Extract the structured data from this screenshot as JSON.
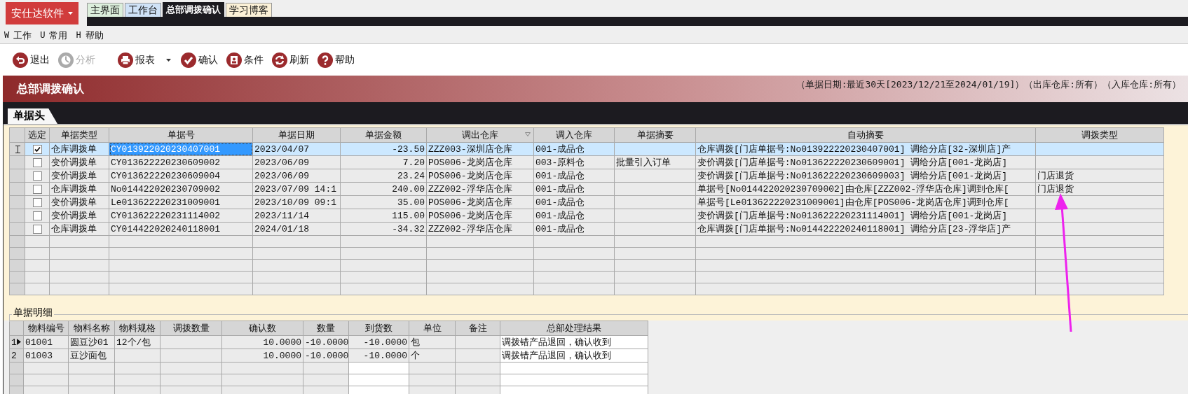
{
  "app_button": {
    "label": "安仕达软件"
  },
  "tabs": [
    {
      "label": "主界面",
      "selected": false,
      "color": "#dcefdc"
    },
    {
      "label": "工作台",
      "selected": false,
      "color": "#cfe2f7"
    },
    {
      "label": "总部调拨确认",
      "selected": true,
      "color": "#1c1b20"
    },
    {
      "label": "学习博客",
      "selected": false,
      "color": "#fbf0d6"
    }
  ],
  "menu": [
    {
      "key": "W",
      "label": "工作"
    },
    {
      "key": "U",
      "label": "常用"
    },
    {
      "key": "H",
      "label": "帮助"
    }
  ],
  "toolbar": [
    {
      "label": "退出",
      "disabled": false
    },
    {
      "label": "分析",
      "disabled": true
    },
    {
      "label": "报表",
      "disabled": false,
      "dropdown": true
    },
    {
      "label": "确认",
      "disabled": false
    },
    {
      "label": "条件",
      "disabled": false
    },
    {
      "label": "刷新",
      "disabled": false
    },
    {
      "label": "帮助",
      "disabled": false
    }
  ],
  "title_band": {
    "title": "总部调拨确认",
    "criteria": "（单据日期:最近30天[2023/12/21至2024/01/19]）（出库仓库:所有）（入库仓库:所有）"
  },
  "header_tab": {
    "label": "单据头"
  },
  "table": {
    "columns": [
      {
        "label": "选定"
      },
      {
        "label": "单据类型"
      },
      {
        "label": "单据号"
      },
      {
        "label": "单据日期"
      },
      {
        "label": "单据金额"
      },
      {
        "label": "调出仓库",
        "filter": true
      },
      {
        "label": "调入仓库"
      },
      {
        "label": "单据摘要"
      },
      {
        "label": "自动摘要"
      },
      {
        "label": "调拨类型"
      }
    ],
    "rows": [
      {
        "selected": true,
        "current": true,
        "checked": true,
        "cells": [
          "",
          "仓库调拨单",
          "CY013922020230407001",
          "2023/04/07",
          "-23.50",
          "ZZZ003-深圳店仓库",
          "001-成品仓",
          null,
          "仓库调拨[门店单据号:No013922220230407001] 调给分店[32-深圳店]产",
          null
        ]
      },
      {
        "selected": false,
        "current": false,
        "checked": false,
        "cells": [
          "",
          "变价调拨单",
          "CY013622220230609002",
          "2023/06/09",
          "7.20",
          "POS006-龙岗店仓库",
          "003-原料仓",
          "批量引入订单",
          "变价调拨[门店单据号:No013622220230609001] 调给分店[001-龙岗店]",
          null
        ]
      },
      {
        "selected": false,
        "current": false,
        "checked": false,
        "cells": [
          "",
          "变价调拨单",
          "CY013622220230609004",
          "2023/06/09",
          "23.24",
          "POS006-龙岗店仓库",
          "001-成品仓",
          null,
          "变价调拨[门店单据号:No013622220230609003] 调给分店[001-龙岗店]",
          "门店退货"
        ]
      },
      {
        "selected": false,
        "current": false,
        "checked": false,
        "cells": [
          "",
          "仓库调拨单",
          "No014422020230709002",
          "2023/07/09 14:1",
          "240.00",
          "ZZZ002-浮华店仓库",
          "001-成品仓",
          null,
          "单据号[No014422020230709002]由仓库[ZZZ002-浮华店仓库]调到仓库[",
          "门店退货"
        ]
      },
      {
        "selected": false,
        "current": false,
        "checked": false,
        "cells": [
          "",
          "变价调拨单",
          "Le013622220231009001",
          "2023/10/09 09:1",
          "35.00",
          "POS006-龙岗店仓库",
          "001-成品仓",
          null,
          "单据号[Le013622220231009001]由仓库[POS006-龙岗店仓库]调到仓库[",
          null
        ]
      },
      {
        "selected": false,
        "current": false,
        "checked": false,
        "cells": [
          "",
          "变价调拨单",
          "CY013622220231114002",
          "2023/11/14",
          "115.00",
          "POS006-龙岗店仓库",
          "001-成品仓",
          null,
          "变价调拨[门店单据号:No013622220231114001] 调给分店[001-龙岗店]",
          null
        ]
      },
      {
        "selected": false,
        "current": false,
        "checked": false,
        "cells": [
          "",
          "仓库调拨单",
          "CY014422020240118001",
          "2024/01/18",
          "-34.32",
          "ZZZ002-浮华店仓库",
          "001-成品仓",
          null,
          "仓库调拨[门店单据号:No014422220240118001] 调给分店[23-浮华店]产",
          null
        ]
      }
    ]
  },
  "detail": {
    "title": "单据明细",
    "columns": [
      {
        "label": "物料编号"
      },
      {
        "label": "物料名称"
      },
      {
        "label": "物料规格"
      },
      {
        "label": "调拨数量"
      },
      {
        "label": "确认数"
      },
      {
        "label": "数量"
      },
      {
        "label": "到货数"
      },
      {
        "label": "单位"
      },
      {
        "label": "备注"
      },
      {
        "label": "总部处理结果"
      }
    ],
    "rows": [
      {
        "number": "1",
        "current": true,
        "cells": [
          "01001",
          "圆豆沙01",
          "12个/包",
          null,
          "10.0000",
          "-10.0000",
          "-10.0000",
          "包",
          null,
          "调拨错产品退回，确认收到"
        ]
      },
      {
        "number": "2",
        "current": false,
        "cells": [
          "01003",
          "豆沙面包",
          null,
          null,
          "10.0000",
          "-10.0000",
          "-10.0000",
          "个",
          null,
          "调拨错产品退回，确认收到"
        ]
      }
    ]
  }
}
